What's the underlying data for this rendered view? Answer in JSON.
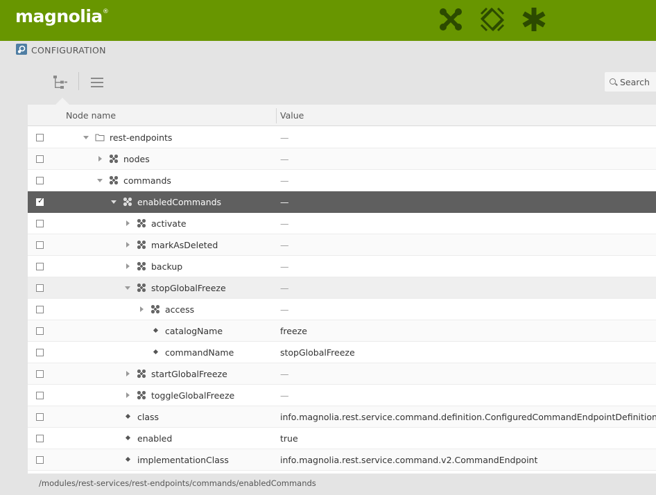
{
  "app": {
    "logo": "magnolia",
    "logo_mark": "®",
    "brand_color": "#689600"
  },
  "header_icons": [
    "apps-launcher-icon",
    "pulse-icon",
    "favorites-icon"
  ],
  "breadcrumb": {
    "app_name": "CONFIGURATION"
  },
  "toolbar": {
    "search_label": "Search"
  },
  "grid": {
    "columns": [
      "Node name",
      "Value"
    ],
    "rows": [
      {
        "name": "rest-endpoints",
        "value": "—",
        "kind": "folder",
        "expand": "down"
      },
      {
        "name": "nodes",
        "value": "—",
        "kind": "content",
        "expand": "right"
      },
      {
        "name": "commands",
        "value": "—",
        "kind": "content",
        "expand": "down"
      },
      {
        "name": "enabledCommands",
        "value": "—",
        "kind": "content",
        "expand": "down",
        "selected": true
      },
      {
        "name": "activate",
        "value": "—",
        "kind": "content",
        "expand": "right"
      },
      {
        "name": "markAsDeleted",
        "value": "—",
        "kind": "content",
        "expand": "right"
      },
      {
        "name": "backup",
        "value": "—",
        "kind": "content",
        "expand": "right"
      },
      {
        "name": "stopGlobalFreeze",
        "value": "—",
        "kind": "content",
        "expand": "down"
      },
      {
        "name": "access",
        "value": "—",
        "kind": "content",
        "expand": "right"
      },
      {
        "name": "catalogName",
        "value": "freeze",
        "kind": "property"
      },
      {
        "name": "commandName",
        "value": "stopGlobalFreeze",
        "kind": "property"
      },
      {
        "name": "startGlobalFreeze",
        "value": "—",
        "kind": "content",
        "expand": "right"
      },
      {
        "name": "toggleGlobalFreeze",
        "value": "—",
        "kind": "content",
        "expand": "right"
      },
      {
        "name": "class",
        "value": "info.magnolia.rest.service.command.definition.ConfiguredCommandEndpointDefinition",
        "kind": "property"
      },
      {
        "name": "enabled",
        "value": "true",
        "kind": "property"
      },
      {
        "name": "implementationClass",
        "value": "info.magnolia.rest.service.command.v2.CommandEndpoint",
        "kind": "property"
      }
    ]
  },
  "status": {
    "path": "/modules/rest-services/rest-endpoints/commands/enabledCommands"
  }
}
